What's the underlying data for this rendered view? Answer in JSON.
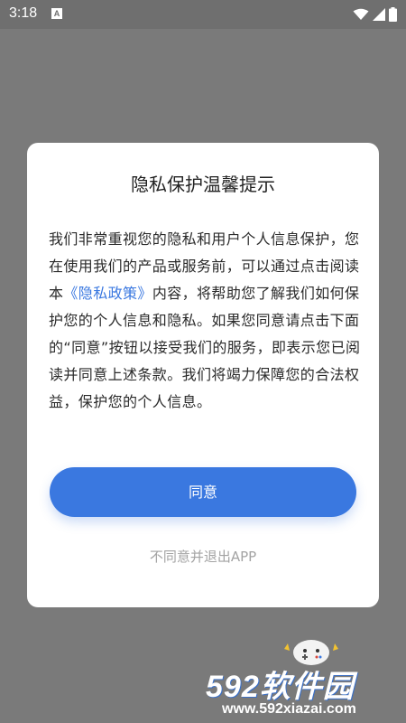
{
  "status_bar": {
    "time": "3:18",
    "notification_letter": "A",
    "icons": [
      "wifi-icon",
      "signal-icon",
      "battery-icon"
    ]
  },
  "dialog": {
    "title": "隐私保护温馨提示",
    "body_before_link": "我们非常重视您的隐私和用户个人信息保护，您在使用我们的产品或服务前，可以通过点击阅读本",
    "policy_link": "《隐私政策》",
    "body_after_link": "内容，将帮助您了解我们如何保护您的个人信息和隐私。如果您同意请点击下面的“同意”按钮以接受我们的服务，即表示您已阅读并同意上述条款。我们将竭力保障您的合法权益，保护您的个人信息。",
    "agree_label": "同意",
    "disagree_label": "不同意并退出APP"
  },
  "watermark": {
    "logo_text": "592软件园",
    "url": "www.592xiazai.com"
  },
  "colors": {
    "accent": "#3a78e0",
    "overlay": "#7a7a7a",
    "secondary_text": "#a3a3a3"
  }
}
